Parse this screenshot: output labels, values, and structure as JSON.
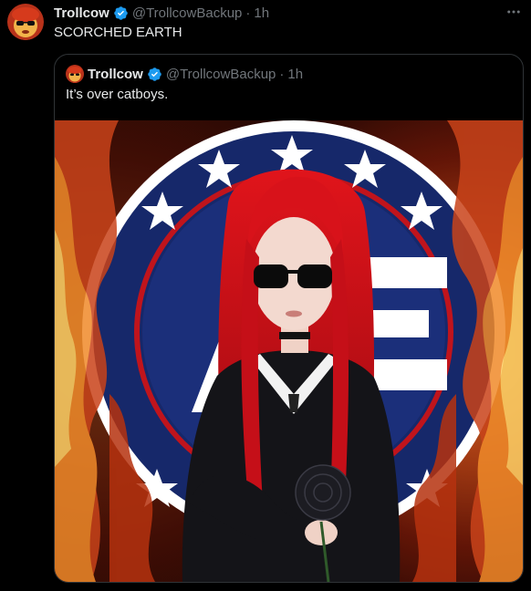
{
  "tweet": {
    "author_name": "Trollcow",
    "author_handle": "@TrollcowBackup",
    "separator": "·",
    "time": "1h",
    "text": "SCORCHED EARTH",
    "more_icon": "more-horizontal-icon",
    "verified_icon": "verified-badge-icon"
  },
  "quoted_tweet": {
    "author_name": "Trollcow",
    "author_handle": "@TrollcowBackup",
    "separator": "·",
    "time": "1h",
    "text": "It’s over catboys."
  },
  "colors": {
    "background": "#000000",
    "text_primary": "#e7e9ea",
    "text_secondary": "#71767b",
    "border": "#2f3336",
    "verified_blue": "#1d9bf0"
  }
}
